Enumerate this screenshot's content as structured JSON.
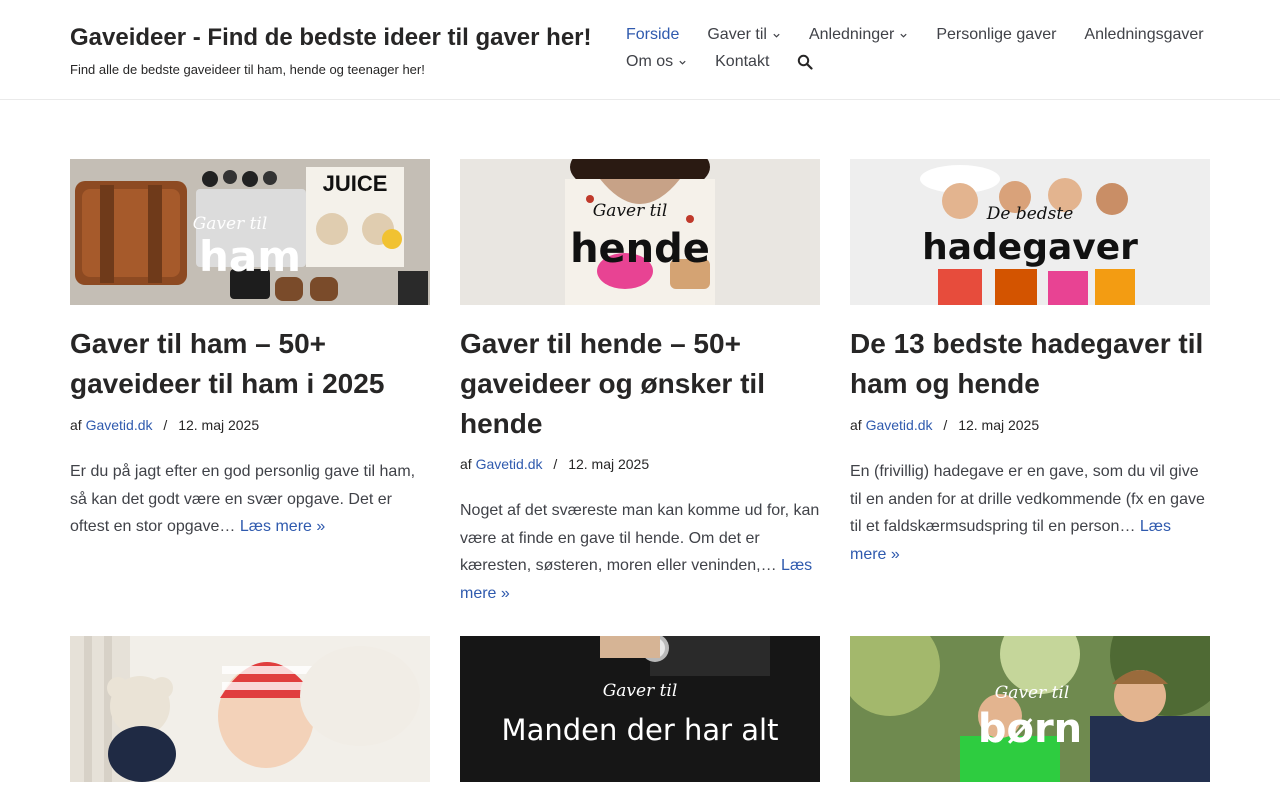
{
  "site": {
    "title": "Gaveideer - Find de bedste ideer til gaver her!",
    "tagline": "Find alle de bedste gaveideer til ham, hende og teenager her!"
  },
  "nav": {
    "items": [
      {
        "label": "Forside",
        "active": true,
        "dropdown": false
      },
      {
        "label": "Gaver til",
        "active": false,
        "dropdown": true
      },
      {
        "label": "Anledninger",
        "active": false,
        "dropdown": true
      },
      {
        "label": "Personlige gaver",
        "active": false,
        "dropdown": false
      },
      {
        "label": "Anledningsgaver",
        "active": false,
        "dropdown": false
      },
      {
        "label": "Om os",
        "active": false,
        "dropdown": true
      },
      {
        "label": "Kontakt",
        "active": false,
        "dropdown": false
      }
    ],
    "search_icon": "search-icon"
  },
  "posts": [
    {
      "image_script": "Gaver til",
      "image_word": "ham",
      "image_juice": "JUICE",
      "title": "Gaver til ham – 50+ gaveideer til ham i 2025",
      "meta_prefix": "af",
      "author": "Gavetid.dk",
      "separator": "/",
      "date": "12. maj 2025",
      "excerpt": "Er du på jagt efter en god personlig gave til ham, så kan det godt være en svær opgave. Det er oftest en stor opgave…",
      "read_more": "Læs mere »"
    },
    {
      "image_script": "Gaver til",
      "image_word": "hende",
      "title": "Gaver til hende – 50+ gaveideer og ønsker til hende",
      "meta_prefix": "af",
      "author": "Gavetid.dk",
      "separator": "/",
      "date": "12. maj 2025",
      "excerpt": "Noget af det sværeste man kan komme ud for, kan være at finde en gave til hende. Om det er kæresten, søsteren, moren eller veninden,…",
      "read_more": "Læs mere »"
    },
    {
      "image_script": "De bedste",
      "image_word": "hadegaver",
      "title": "De 13 bedste hadegaver til ham og hende",
      "meta_prefix": "af",
      "author": "Gavetid.dk",
      "separator": "/",
      "date": "12. maj 2025",
      "excerpt": "En (frivillig) hadegave er en gave, som du vil give til en anden for at drille vedkommende (fx en gave til et faldskærmsudspring til en person…",
      "read_more": "Læs mere »"
    }
  ],
  "bottom_images": [
    {
      "script": "",
      "word": ""
    },
    {
      "script": "Gaver til",
      "word": "Manden der har alt"
    },
    {
      "script": "Gaver til",
      "word": "børn"
    }
  ],
  "colors": {
    "link": "#2f5aae",
    "text": "#272626",
    "body_text": "#404248"
  }
}
